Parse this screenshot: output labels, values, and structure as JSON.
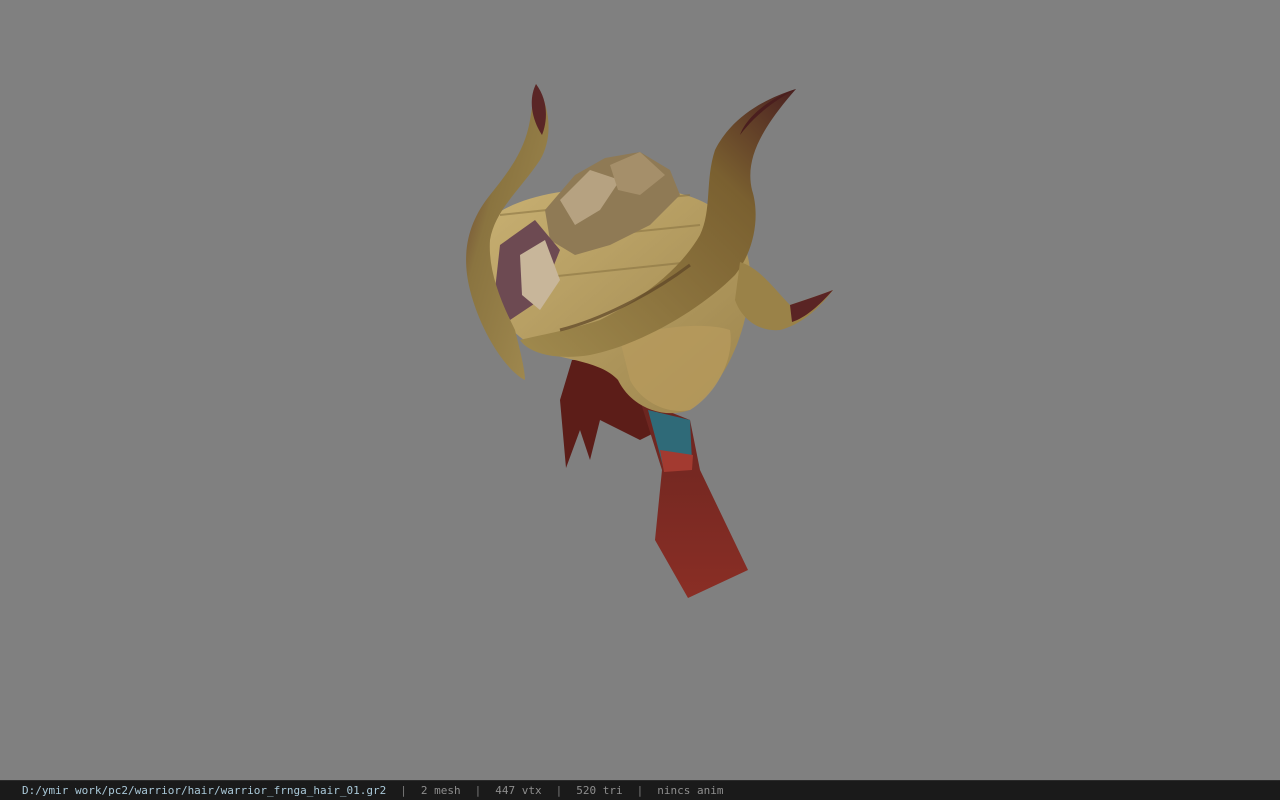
{
  "viewer": {
    "background_color": "#808080",
    "model_name": "warrior_frnga_hair_01"
  },
  "status_bar": {
    "file_path": "D:/ymir work/pc2/warrior/hair/warrior_frnga_hair_01.gr2",
    "separator": "|",
    "mesh_count": "2 mesh",
    "vertex_count": "447 vtx",
    "triangle_count": "520 tri",
    "animation": "nincs anim"
  }
}
